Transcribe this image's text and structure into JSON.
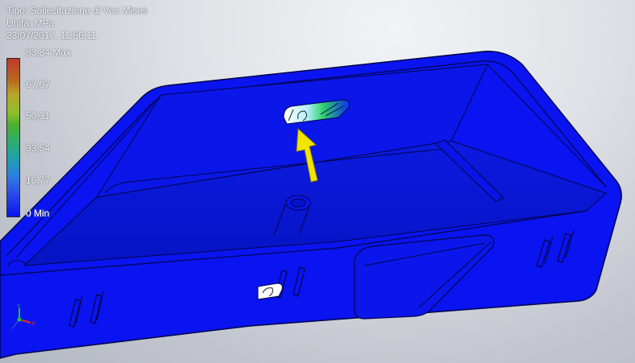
{
  "result": {
    "type_line": "Tipo: Sollecitazione di Von Mises",
    "unit_line": "Unità: MPa",
    "date_line": "23/07/2017, 11:56:11"
  },
  "legend": {
    "labels": [
      "83,84 Max",
      "67,07",
      "50,31",
      "33,54",
      "16,77",
      "0 Min"
    ],
    "colors": [
      "#c0392b",
      "#b8a22a",
      "#4caf2f",
      "#1fa3a8",
      "#2d52e6",
      "#0000ff"
    ]
  },
  "model": {
    "surface_color": "#0a14f0",
    "highlight_color": "#ffffff",
    "arrow_color": "#f0e400"
  },
  "triad": {
    "x_label": "X",
    "y_label": "Y",
    "z_label": "Z"
  }
}
